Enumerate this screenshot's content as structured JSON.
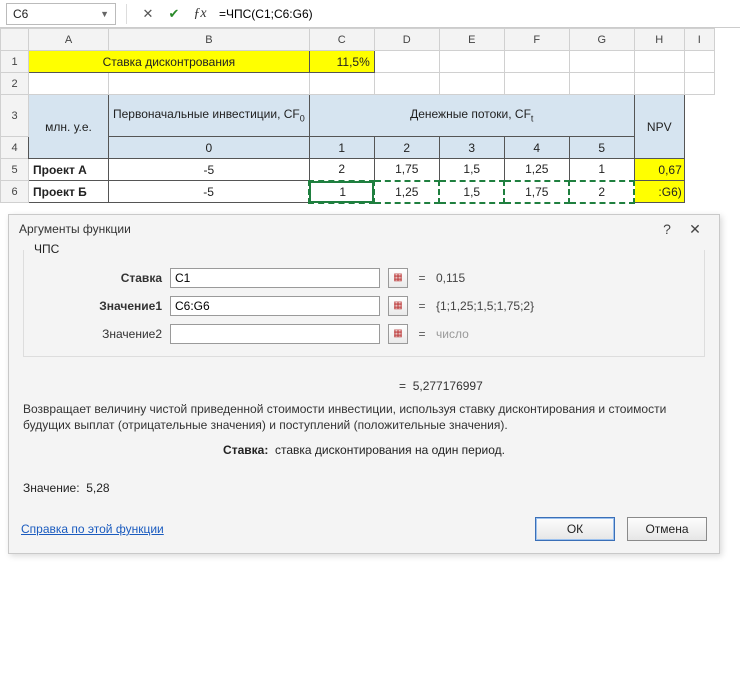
{
  "formula_bar": {
    "name_box": "C6",
    "formula": "=ЧПС(C1;C6:G6)"
  },
  "columns": [
    "A",
    "B",
    "C",
    "D",
    "E",
    "F",
    "G",
    "H",
    "I"
  ],
  "rows": [
    "1",
    "2",
    "3",
    "4",
    "5",
    "6"
  ],
  "grid": {
    "r1": {
      "A_B": "Ставка дисконтрования",
      "C": "11,5%"
    },
    "r3": {
      "A": "млн. у.е.",
      "B": "Первоначальные инвестиции, CF",
      "Bsub": "0",
      "CF_header": "Денежные потоки, CF",
      "CF_sub": "t",
      "H": "NPV"
    },
    "r4": {
      "B": "0",
      "C": "1",
      "D": "2",
      "E": "3",
      "F": "4",
      "G": "5"
    },
    "r5": {
      "A": "Проект А",
      "B": "-5",
      "C": "2",
      "D": "1,75",
      "E": "1,5",
      "F": "1,25",
      "G": "1",
      "H": "0,67"
    },
    "r6": {
      "A": "Проект Б",
      "B": "-5",
      "C": "1",
      "D": "1,25",
      "E": "1,5",
      "F": "1,75",
      "G": "2",
      "H": ":G6)"
    }
  },
  "dialog": {
    "title": "Аргументы функции",
    "func": "ЧПС",
    "args": {
      "rate": {
        "label": "Ставка",
        "value": "C1",
        "result": "0,115"
      },
      "val1": {
        "label": "Значение1",
        "value": "C6:G6",
        "result": "{1;1,25;1,5;1,75;2}"
      },
      "val2": {
        "label": "Значение2",
        "value": "",
        "result": "число"
      }
    },
    "preview": "5,277176997",
    "desc": "Возвращает величину чистой приведенной стоимости инвестиции, используя ставку дисконтирования и стоимости будущих выплат (отрицательные значения) и поступлений (положительные значения).",
    "arg_help_label": "Ставка:",
    "arg_help": "ставка дисконтирования на один период.",
    "value_label": "Значение:",
    "value": "5,28",
    "help_link": "Справка по этой функции",
    "ok": "ОК",
    "cancel": "Отмена"
  }
}
